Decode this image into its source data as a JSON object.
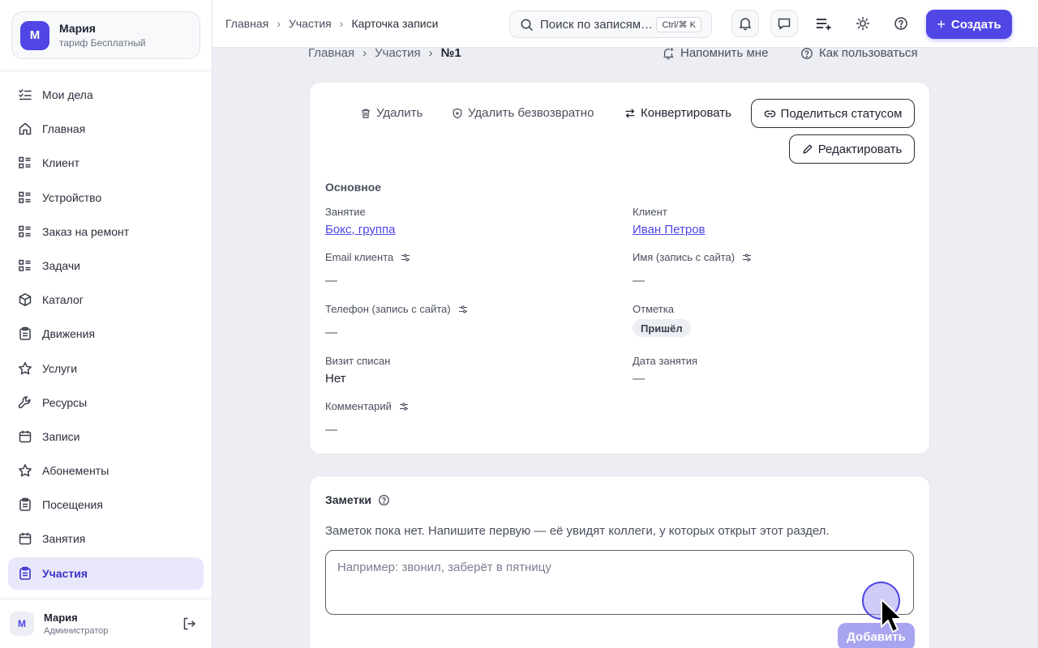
{
  "workspace": {
    "initial": "М",
    "name": "Мария",
    "plan": "тариф Бесплатный"
  },
  "sidebar": {
    "items": [
      {
        "label": "Мои дела",
        "icon": "list-check-icon"
      },
      {
        "label": "Главная",
        "icon": "home-icon"
      },
      {
        "label": "Клиент",
        "icon": "list-grid-icon"
      },
      {
        "label": "Устройство",
        "icon": "list-grid-icon"
      },
      {
        "label": "Заказ на ремонт",
        "icon": "list-grid-icon"
      },
      {
        "label": "Задачи",
        "icon": "list-grid-icon"
      },
      {
        "label": "Каталог",
        "icon": "box-icon"
      },
      {
        "label": "Движения",
        "icon": "clipboard-icon"
      },
      {
        "label": "Услуги",
        "icon": "star-icon"
      },
      {
        "label": "Ресурсы",
        "icon": "wrench-icon"
      },
      {
        "label": "Записи",
        "icon": "calendar-icon"
      },
      {
        "label": "Абонементы",
        "icon": "star-icon"
      },
      {
        "label": "Посещения",
        "icon": "clipboard-icon"
      },
      {
        "label": "Занятия",
        "icon": "calendar-icon"
      },
      {
        "label": "Участия",
        "icon": "clipboard-icon",
        "active": true
      }
    ]
  },
  "user": {
    "initial": "М",
    "name": "Мария",
    "role": "Администратор"
  },
  "topbar": {
    "breadcrumbs": [
      "Главная",
      "Участия",
      "Карточка записи"
    ],
    "search_placeholder": "Поиск по записям",
    "search_shortcut": "Ctrl/⌘ K",
    "create_label": "Создать"
  },
  "page": {
    "breadcrumbs": [
      "Главная",
      "Участия",
      "№1"
    ],
    "remind_label": "Напомнить мне",
    "howto_label": "Как пользоваться"
  },
  "actions": {
    "delete": "Удалить",
    "delete_forever": "Удалить безвозвратно",
    "convert": "Конвертировать",
    "share_status": "Поделиться статусом",
    "edit": "Редактировать"
  },
  "record": {
    "section": "Основное",
    "fields": {
      "lesson_label": "Занятие",
      "lesson_value": "Бокс, группа",
      "client_label": "Клиент",
      "client_value": "Иван Петров",
      "email_label": "Email клиента",
      "email_value": "—",
      "name_site_label": "Имя (запись с сайта)",
      "name_site_value": "—",
      "phone_label": "Телефон (запись с сайта)",
      "phone_value": "—",
      "mark_label": "Отметка",
      "mark_value": "Пришёл",
      "visit_label": "Визит списан",
      "visit_value": "Нет",
      "date_label": "Дата занятия",
      "date_value": "—",
      "comment_label": "Комментарий",
      "comment_value": "—"
    }
  },
  "notes": {
    "title": "Заметки",
    "empty_text": "Заметок пока нет. Напишите первую — её увидят коллеги, у которых открыт этот раздел.",
    "placeholder": "Например: звонил, заберёт в пятницу",
    "add_label": "Добавить"
  },
  "colors": {
    "accent": "#4f46e5",
    "active_bg": "#e9e8fb",
    "page_bg": "#eceef3"
  }
}
